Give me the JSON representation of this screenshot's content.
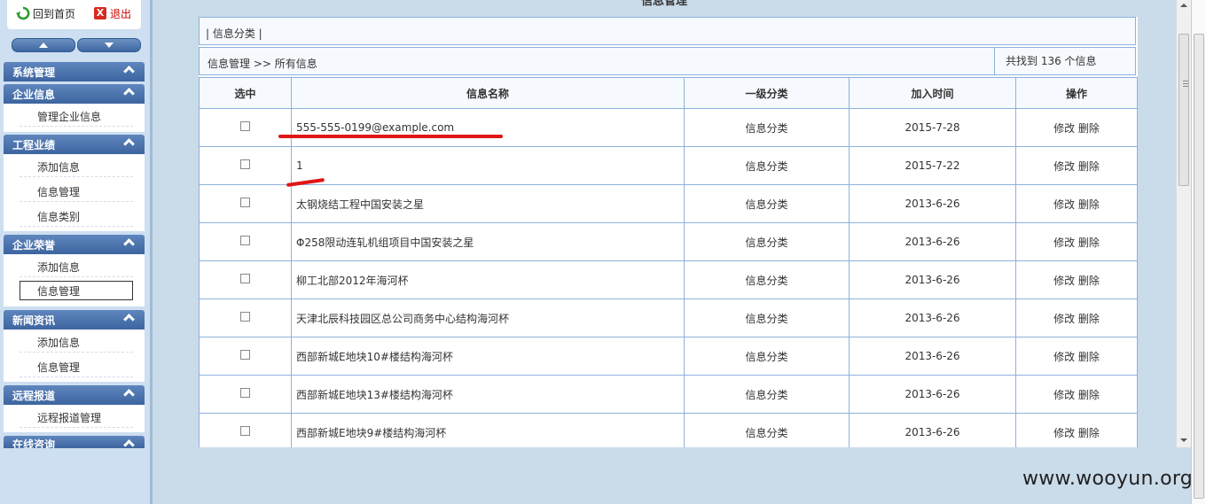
{
  "topbar": {
    "home_label": "回到首页",
    "logout_label": "退出",
    "logout_icon_text": "X"
  },
  "heading": "信息管理",
  "sidebar": {
    "sections": [
      {
        "title": "系统管理",
        "items": []
      },
      {
        "title": "企业信息",
        "items": [
          "管理企业信息"
        ]
      },
      {
        "title": "工程业绩",
        "items": [
          "添加信息",
          "信息管理",
          "信息类别"
        ]
      },
      {
        "title": "企业荣誉",
        "items": [
          "添加信息",
          "信息管理"
        ]
      },
      {
        "title": "新闻资讯",
        "items": [
          "添加信息",
          "信息管理"
        ]
      },
      {
        "title": "远程报道",
        "items": [
          "远程报道管理"
        ]
      },
      {
        "title": "在线咨询",
        "items": []
      }
    ]
  },
  "category_bar": "|  信息分类  |",
  "breadcrumb": "信息管理 >> 所有信息",
  "count_text": "共找到 136 个信息",
  "table": {
    "headers": [
      "选中",
      "信息名称",
      "一级分类",
      "加入时间",
      "操作"
    ],
    "rows": [
      {
        "name": "555-555-0199@example.com",
        "category": "信息分类",
        "date": "2015-7-28"
      },
      {
        "name": "1",
        "category": "信息分类",
        "date": "2015-7-22"
      },
      {
        "name": "太钢烧结工程中国安装之星",
        "category": "信息分类",
        "date": "2013-6-26"
      },
      {
        "name": "Φ258限动连轧机组项目中国安装之星",
        "category": "信息分类",
        "date": "2013-6-26"
      },
      {
        "name": "柳工北部2012年海河杯",
        "category": "信息分类",
        "date": "2013-6-26"
      },
      {
        "name": "天津北辰科技园区总公司商务中心结构海河杯",
        "category": "信息分类",
        "date": "2013-6-26"
      },
      {
        "name": "西部新城E地块10#楼结构海河杯",
        "category": "信息分类",
        "date": "2013-6-26"
      },
      {
        "name": "西部新城E地块13#楼结构海河杯",
        "category": "信息分类",
        "date": "2013-6-26"
      },
      {
        "name": "西部新城E地块9#楼结构海河杯",
        "category": "信息分类",
        "date": "2013-6-26"
      }
    ],
    "edit_label": "修改",
    "delete_label": "删除"
  },
  "watermark": "www.wooyun.org",
  "colors": {
    "sidebar_header": "#3c649f",
    "border": "#8db2dc",
    "annotation": "#e01515"
  }
}
